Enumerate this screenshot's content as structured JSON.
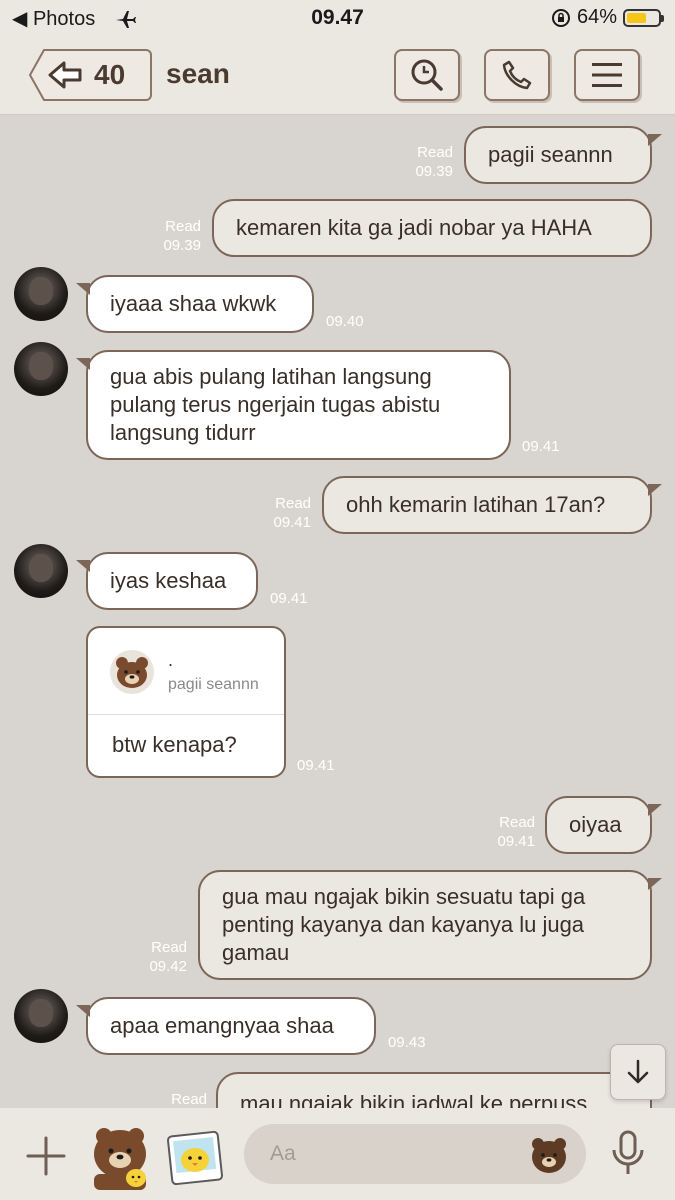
{
  "status_bar": {
    "back_app": "◀ Photos",
    "time": "09.47",
    "battery": "64%",
    "battery_level": 0.64
  },
  "header": {
    "back_count": "40",
    "title": "sean"
  },
  "messages": [
    {
      "id": "m1",
      "dir": "out",
      "text": "pagii seannn",
      "read": "Read",
      "time": "09.39"
    },
    {
      "id": "m2",
      "dir": "out",
      "text": "kemaren kita ga jadi nobar ya HAHA",
      "read": "Read",
      "time": "09.39"
    },
    {
      "id": "m3",
      "dir": "in",
      "text": "iyaaa shaa wkwk",
      "time": "09.40"
    },
    {
      "id": "m4",
      "dir": "in",
      "text": "gua abis pulang latihan langsung pulang terus ngerjain tugas abistu langsung tidurr",
      "time": "09.41"
    },
    {
      "id": "m5",
      "dir": "out",
      "text": "ohh kemarin latihan 17an?",
      "read": "Read",
      "time": "09.41"
    },
    {
      "id": "m6",
      "dir": "in",
      "text": "iyas keshaa",
      "time": "09.41"
    },
    {
      "id": "m7",
      "dir": "in",
      "reply_name": ".",
      "reply_quote": "pagii seannn",
      "text": "btw kenapa?",
      "time": "09.41"
    },
    {
      "id": "m8",
      "dir": "out",
      "text": "oiyaa",
      "read": "Read",
      "time": "09.41"
    },
    {
      "id": "m9",
      "dir": "out",
      "text": "gua mau ngajak bikin sesuatu tapi ga penting kayanya dan kayanya lu juga gamau",
      "read": "Read",
      "time": "09.42"
    },
    {
      "id": "m10",
      "dir": "in",
      "text": "apaa emangnyaa shaa",
      "time": "09.43"
    },
    {
      "id": "m11",
      "dir": "out",
      "text": "mau ngajak bikin jadwal ke perpuss",
      "read": "Read"
    }
  ],
  "composer": {
    "placeholder": "Aa"
  }
}
